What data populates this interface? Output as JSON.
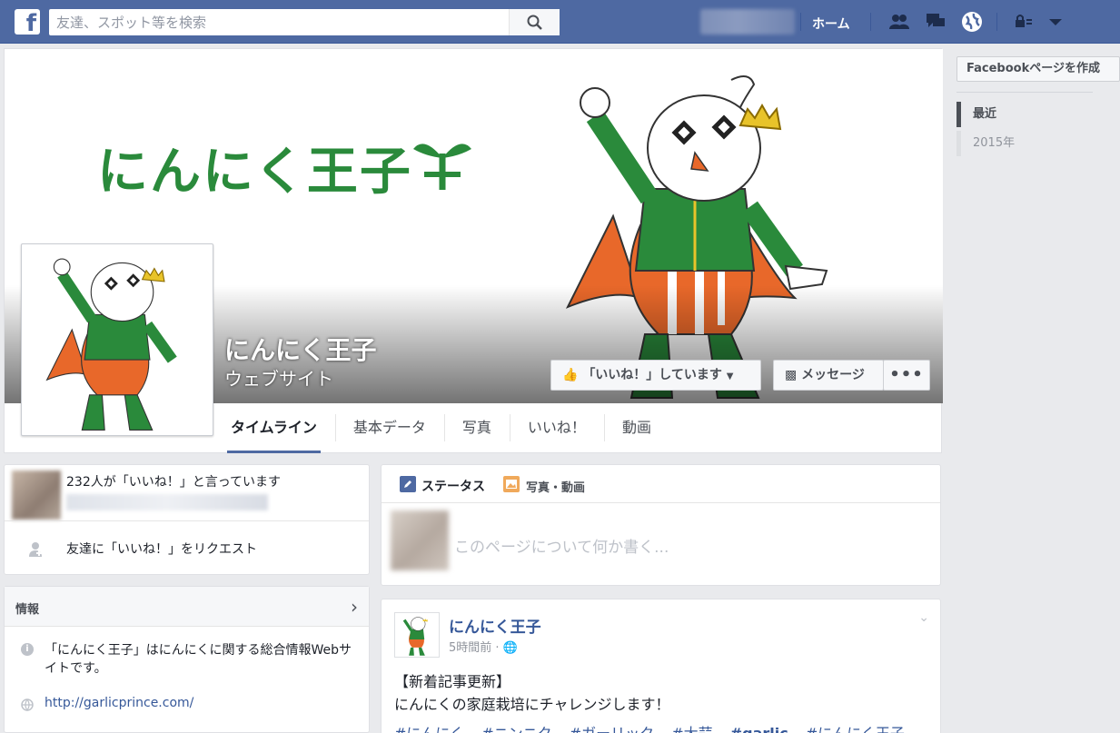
{
  "topbar": {
    "logo": "f",
    "search_placeholder": "友達、スポット等を検索",
    "home_label": "ホーム"
  },
  "page": {
    "cover_title": "にんにく王子",
    "name": "にんにく王子",
    "category": "ウェブサイト",
    "like_button": "「いいね！」しています",
    "message_button": "メッセージ",
    "more_button": "•••"
  },
  "tabs": [
    "タイムライン",
    "基本データ",
    "写真",
    "いいね！",
    "動画"
  ],
  "likes": {
    "count_text": "232人が「いいね！」と言っています",
    "request_text": "友達に「いいね！」をリクエスト"
  },
  "info": {
    "title": "情報",
    "description": "「にんにく王子」はにんにくに関する総合情報Webサイトです。",
    "link": "http://garlicprince.com/"
  },
  "composer": {
    "status_tab": "ステータス",
    "photo_tab": "写真・動画",
    "placeholder": "このページについて何か書く..."
  },
  "post": {
    "author": "にんにく王子",
    "time": "5時間前 ·",
    "line1": "【新着記事更新】",
    "line2": "にんにくの家庭栽培にチャレンジします！",
    "tags": [
      "#にんにく",
      "#ニンニク",
      "#ガーリック",
      "#大蒜",
      "#garlic",
      "#にんにく王子"
    ]
  },
  "right": {
    "create_page": "Facebookページを作成",
    "years": [
      "最近",
      "2015年"
    ]
  },
  "colors": {
    "brand": "#4e69a2",
    "link": "#365899",
    "garlic_green": "#2a8a3b",
    "cape_orange": "#e8682a"
  }
}
